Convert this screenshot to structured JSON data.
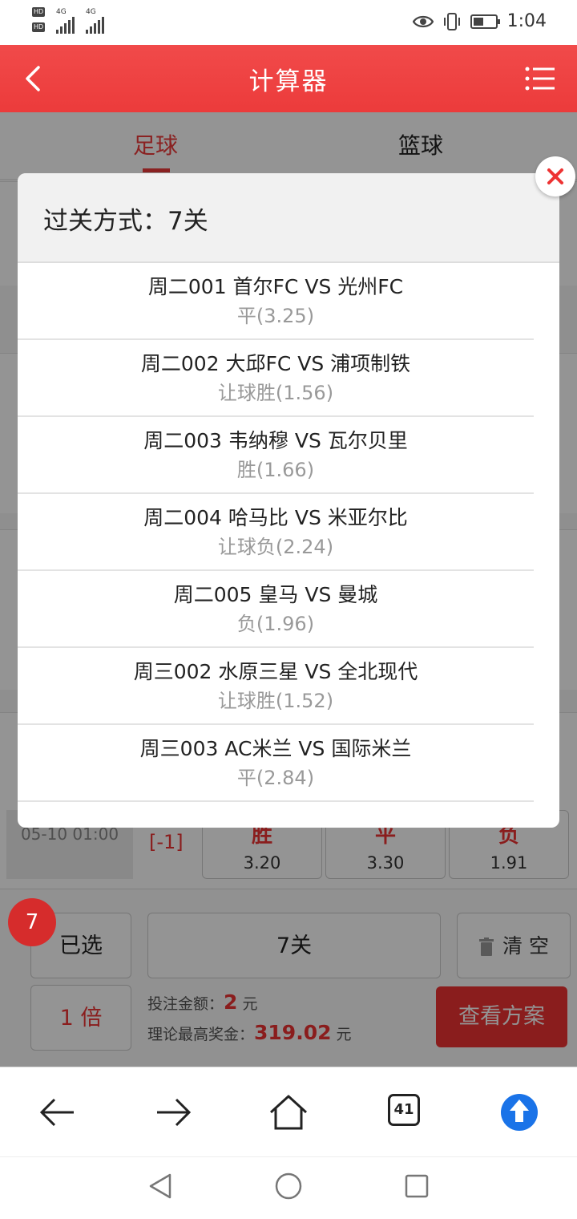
{
  "status_bar": {
    "time": "1:04",
    "hd1": "HD",
    "hd2": "HD",
    "net1": "4G",
    "net2": "4G",
    "icons": [
      "eye-icon",
      "vibrate-icon",
      "battery-icon"
    ],
    "battery_level": 0.45
  },
  "header": {
    "title": "计算器",
    "back_icon": "chevron-left-icon",
    "menu_icon": "list-menu-icon"
  },
  "tabs": [
    {
      "label": "足球",
      "active": true
    },
    {
      "label": "篮球",
      "active": false
    }
  ],
  "background_match": {
    "time": "05-10 01:00",
    "handicap": "[-1]",
    "odds": [
      {
        "label": "胜",
        "value": "3.20"
      },
      {
        "label": "平",
        "value": "3.30"
      },
      {
        "label": "负",
        "value": "1.91"
      }
    ]
  },
  "bottom": {
    "count_badge": "7",
    "selected_label": "已选",
    "pass_label": "7关",
    "clear_label": "清 空",
    "multiplier_label": "1 倍",
    "bet_amount_label": "投注金额：",
    "bet_amount_value": "2",
    "bet_amount_unit": "元",
    "max_prize_label": "理论最高奖金：",
    "max_prize_value": "319.02",
    "max_prize_unit": "元",
    "view_plan_label": "查看方案"
  },
  "modal": {
    "title": "过关方式：7关",
    "matches": [
      {
        "teams": "周二001 首尔FC VS 光州FC",
        "pick": "平(3.25)"
      },
      {
        "teams": "周二002 大邱FC VS 浦项制铁",
        "pick": "让球胜(1.56)"
      },
      {
        "teams": "周二003 韦纳穆 VS 瓦尔贝里",
        "pick": "胜(1.66)"
      },
      {
        "teams": "周二004 哈马比 VS 米亚尔比",
        "pick": "让球负(2.24)"
      },
      {
        "teams": "周二005 皇马 VS 曼城",
        "pick": "负(1.96)"
      },
      {
        "teams": "周三002 水原三星 VS 全北现代",
        "pick": "让球胜(1.52)"
      },
      {
        "teams": "周三003 AC米兰 VS 国际米兰",
        "pick": "平(2.84)"
      }
    ]
  },
  "browser_nav": {
    "tab_count": "41",
    "icons": [
      "arrow-left-icon",
      "arrow-right-icon",
      "home-icon",
      "tabs-icon",
      "upload-icon"
    ]
  },
  "system_nav": {
    "icons": [
      "back-triangle-icon",
      "home-circle-icon",
      "recents-square-icon"
    ]
  },
  "colors": {
    "accent": "#ee3b3b",
    "upload_blue": "#1a73e8"
  }
}
